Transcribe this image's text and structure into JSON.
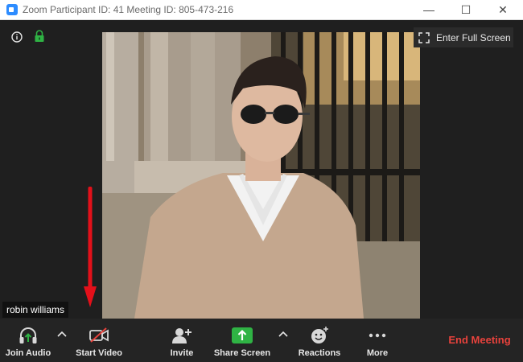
{
  "window": {
    "title": "Zoom Participant ID: 41   Meeting ID: 805-473-216",
    "minimize_glyph": "—",
    "maximize_glyph": "☐",
    "close_glyph": "✕"
  },
  "video": {
    "fullscreen_label": "Enter Full Screen",
    "participant_name": "robin williams"
  },
  "toolbar": {
    "join_audio": "Join Audio",
    "start_video": "Start Video",
    "invite": "Invite",
    "share_screen": "Share Screen",
    "reactions": "Reactions",
    "more": "More",
    "end_meeting": "End Meeting"
  },
  "colors": {
    "accent_green": "#2fb344",
    "end_red": "#e8423c",
    "annotation_arrow": "#e3101a"
  }
}
